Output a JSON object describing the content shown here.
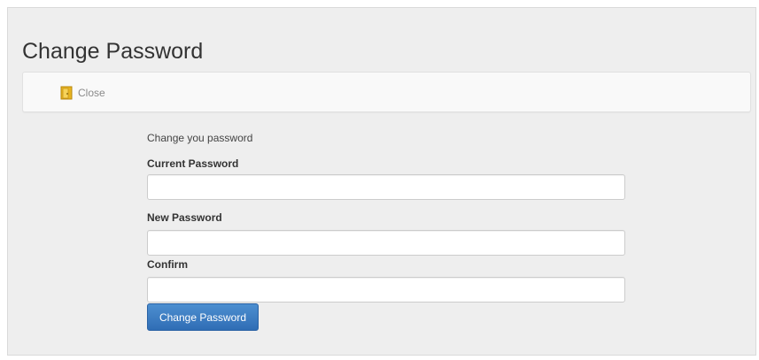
{
  "page": {
    "title": "Change Password"
  },
  "toolbar": {
    "close_label": "Close",
    "close_icon": "exit-door-icon"
  },
  "form": {
    "intro": "Change you password",
    "fields": [
      {
        "label": "Current Password",
        "value": "",
        "placeholder": ""
      },
      {
        "label": "New Password",
        "value": "",
        "placeholder": ""
      },
      {
        "label": "Confirm",
        "value": "",
        "placeholder": ""
      }
    ],
    "submit_label": "Change Password"
  },
  "colors": {
    "panel_background": "#eeeeee",
    "toolbar_background": "#f9f9f9",
    "primary_button": "#3b7bc2",
    "close_icon_fill": "#e8b521"
  }
}
